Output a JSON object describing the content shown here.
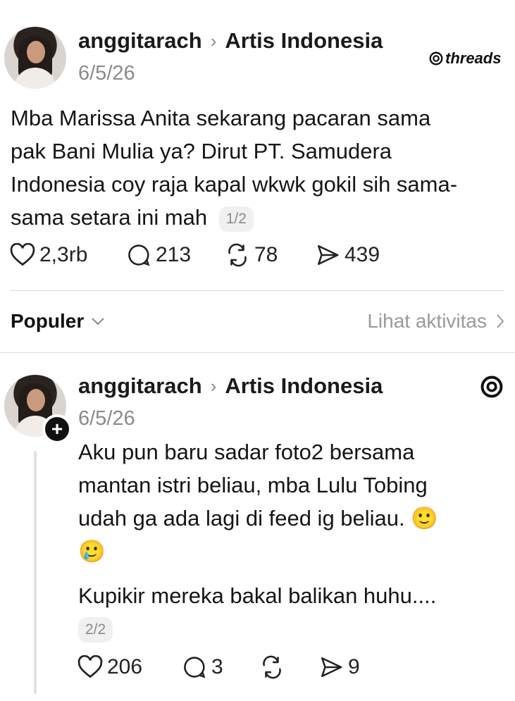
{
  "post": {
    "username": "anggitarach",
    "community": "Artis Indonesia",
    "date": "6/5/26",
    "brand": "threads",
    "text_lines": [
      "Mba Marissa Anita sekarang pacaran sama",
      "pak Bani Mulia ya? Dirut PT. Samudera",
      "Indonesia coy raja kapal wkwk gokil sih sama-",
      "sama setara ini mah"
    ],
    "page_badge": "1/2",
    "likes": "2,3rb",
    "replies": "213",
    "reposts": "78",
    "shares": "439"
  },
  "sort": {
    "label": "Populer",
    "activity_link": "Lihat aktivitas"
  },
  "reply": {
    "username": "anggitarach",
    "community": "Artis Indonesia",
    "date": "6/5/26",
    "text_lines": [
      "Aku pun baru sadar foto2 bersama",
      "mantan istri beliau, mba Lulu Tobing",
      "udah ga ada lagi di feed ig beliau. 🙂",
      "🥲"
    ],
    "text2": "Kupikir mereka bakal balikan huhu....",
    "page_badge": "2/2",
    "likes": "206",
    "replies": "3",
    "reposts": "",
    "shares": "9"
  },
  "icons": [
    "heart-icon",
    "comment-icon",
    "repost-icon",
    "share-icon",
    "threads-logo-icon",
    "chevron-right-icon",
    "chevron-down-icon",
    "follow-plus-icon"
  ]
}
